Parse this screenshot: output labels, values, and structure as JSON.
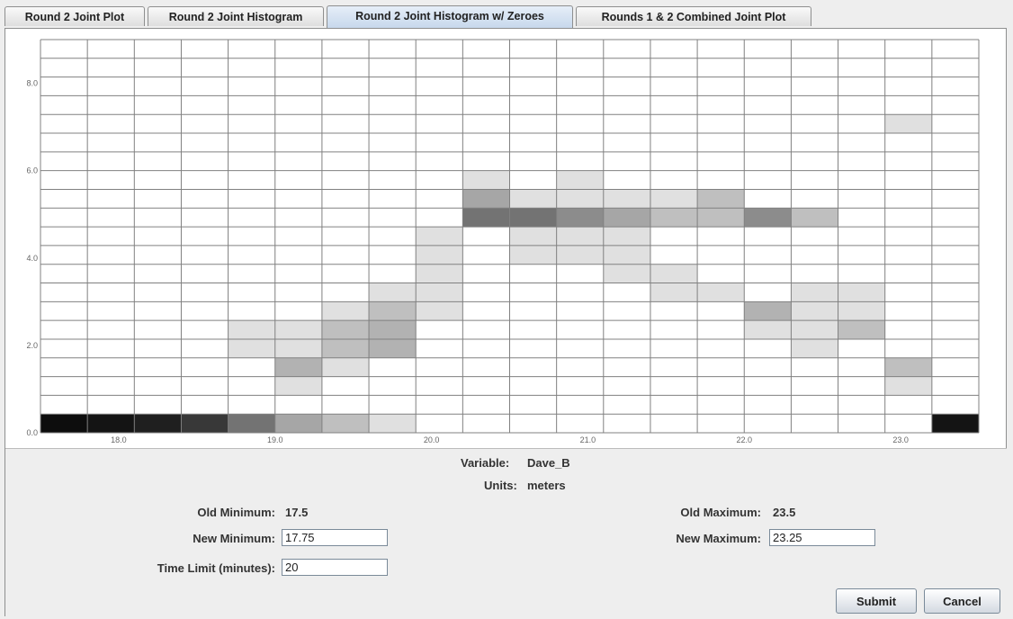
{
  "tabs": [
    {
      "label": "Round 2 Joint Plot",
      "active": false
    },
    {
      "label": "Round 2 Joint Histogram",
      "active": false
    },
    {
      "label": "Round 2 Joint Histogram w/ Zeroes",
      "active": true
    },
    {
      "label": "Rounds 1 & 2 Combined Joint Plot",
      "active": false
    }
  ],
  "chart_data": {
    "type": "heatmap",
    "x_range": [
      17.5,
      23.5
    ],
    "y_range": [
      0.0,
      9.0
    ],
    "x_tick_labels": [
      "18.0",
      "19.0",
      "20.0",
      "21.0",
      "22.0",
      "23.0"
    ],
    "y_tick_labels": [
      "0.0",
      "2.0",
      "4.0",
      "6.0",
      "8.0"
    ],
    "n_cols": 20,
    "n_rows": 21,
    "grid": true,
    "cell_color": "#000000",
    "note_units": "cells hold darkness 0-1, row 0 is the bottom row, column 0 is the leftmost",
    "cells": [
      [
        0,
        0,
        0.95
      ],
      [
        1,
        0,
        0.92
      ],
      [
        2,
        0,
        0.88
      ],
      [
        3,
        0,
        0.78
      ],
      [
        4,
        0,
        0.55
      ],
      [
        5,
        0,
        0.35
      ],
      [
        6,
        0,
        0.25
      ],
      [
        7,
        0,
        0.12
      ],
      [
        19,
        0,
        0.92
      ],
      [
        5,
        2,
        0.12
      ],
      [
        18,
        2,
        0.12
      ],
      [
        5,
        3,
        0.3
      ],
      [
        6,
        3,
        0.12
      ],
      [
        18,
        3,
        0.25
      ],
      [
        4,
        4,
        0.12
      ],
      [
        5,
        4,
        0.12
      ],
      [
        6,
        4,
        0.25
      ],
      [
        7,
        4,
        0.3
      ],
      [
        16,
        4,
        0.12
      ],
      [
        4,
        5,
        0.12
      ],
      [
        5,
        5,
        0.12
      ],
      [
        6,
        5,
        0.25
      ],
      [
        7,
        5,
        0.3
      ],
      [
        15,
        5,
        0.12
      ],
      [
        16,
        5,
        0.12
      ],
      [
        17,
        5,
        0.25
      ],
      [
        6,
        6,
        0.12
      ],
      [
        7,
        6,
        0.25
      ],
      [
        8,
        6,
        0.12
      ],
      [
        15,
        6,
        0.3
      ],
      [
        16,
        6,
        0.12
      ],
      [
        17,
        6,
        0.12
      ],
      [
        7,
        7,
        0.12
      ],
      [
        8,
        7,
        0.12
      ],
      [
        13,
        7,
        0.12
      ],
      [
        14,
        7,
        0.12
      ],
      [
        16,
        7,
        0.12
      ],
      [
        17,
        7,
        0.12
      ],
      [
        8,
        8,
        0.12
      ],
      [
        12,
        8,
        0.12
      ],
      [
        13,
        8,
        0.12
      ],
      [
        8,
        9,
        0.12
      ],
      [
        10,
        9,
        0.12
      ],
      [
        11,
        9,
        0.12
      ],
      [
        12,
        9,
        0.12
      ],
      [
        8,
        10,
        0.12
      ],
      [
        10,
        10,
        0.12
      ],
      [
        11,
        10,
        0.12
      ],
      [
        12,
        10,
        0.12
      ],
      [
        9,
        11,
        0.55
      ],
      [
        10,
        11,
        0.55
      ],
      [
        11,
        11,
        0.45
      ],
      [
        12,
        11,
        0.35
      ],
      [
        13,
        11,
        0.25
      ],
      [
        14,
        11,
        0.25
      ],
      [
        15,
        11,
        0.45
      ],
      [
        16,
        11,
        0.25
      ],
      [
        9,
        12,
        0.35
      ],
      [
        10,
        12,
        0.12
      ],
      [
        11,
        12,
        0.12
      ],
      [
        12,
        12,
        0.12
      ],
      [
        13,
        12,
        0.12
      ],
      [
        14,
        12,
        0.25
      ],
      [
        9,
        13,
        0.12
      ],
      [
        11,
        13,
        0.12
      ],
      [
        18,
        16,
        0.12
      ]
    ]
  },
  "form": {
    "variable_label": "Variable:",
    "variable_value": "Dave_B",
    "units_label": "Units:",
    "units_value": "meters",
    "old_min_label": "Old Minimum:",
    "old_min_value": "17.5",
    "old_max_label": "Old Maximum:",
    "old_max_value": "23.5",
    "new_min_label": "New Minimum:",
    "new_min_value": "17.75",
    "new_max_label": "New Maximum:",
    "new_max_value": "23.25",
    "time_limit_label": "Time Limit (minutes):",
    "time_limit_value": "20",
    "submit_label": "Submit",
    "cancel_label": "Cancel"
  }
}
